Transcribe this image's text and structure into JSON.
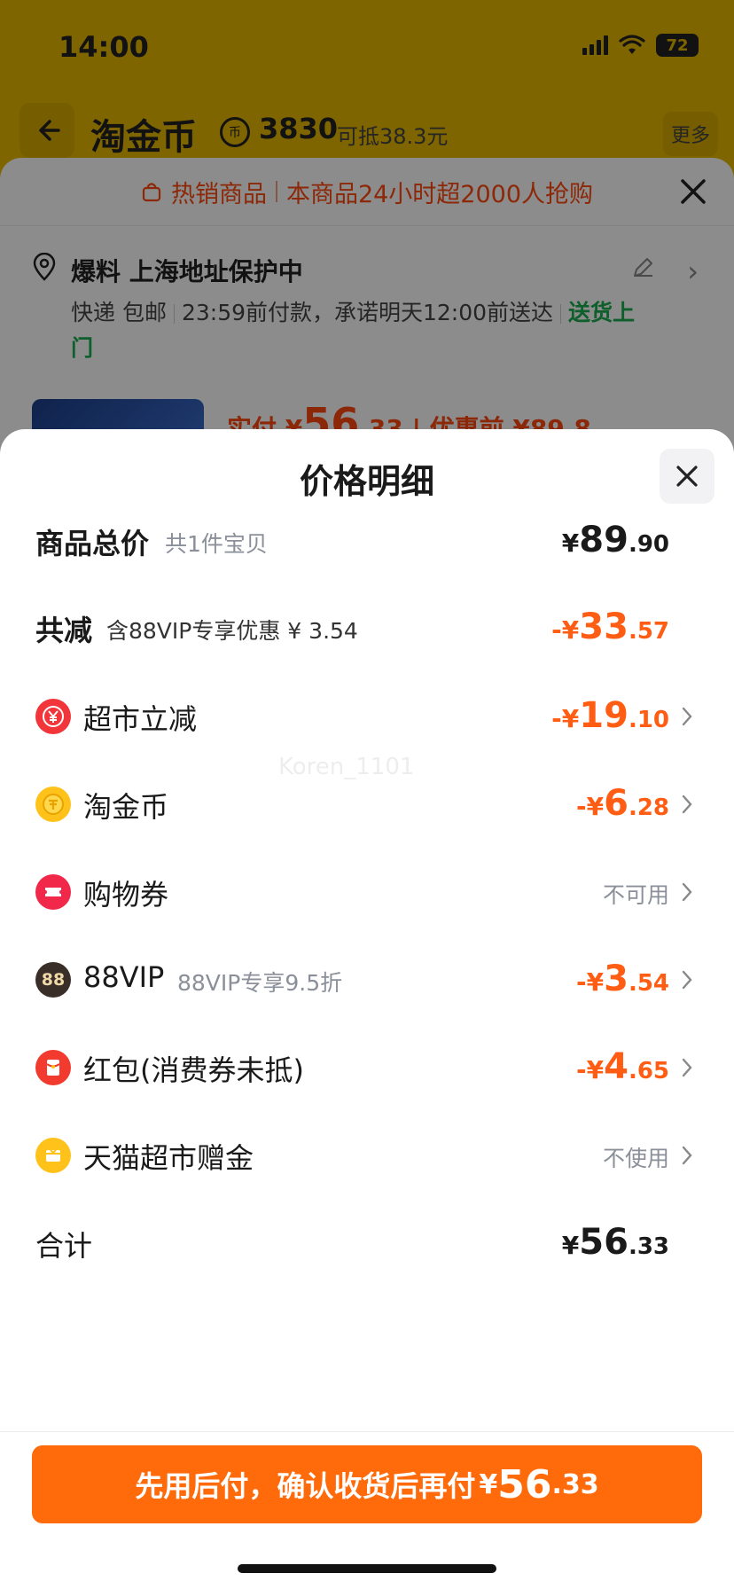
{
  "status_bar": {
    "time": "14:00",
    "battery": "72"
  },
  "nav": {
    "title": "淘金币",
    "coin_icon": "coin-icon",
    "coins": "3830",
    "deduct_text": "可抵38.3元",
    "more": "更多"
  },
  "order": {
    "banner_hot": "热销商品",
    "banner_text": "本商品24小时超2000人抢购",
    "address_title": "爆料 上海地址保护中",
    "delivery_method": "快递 包邮",
    "delivery_promise": "23:59前付款，承诺明天12:00前送达",
    "delivery_tag": "送货上门",
    "paid_prefix": "实付 ¥",
    "paid_int": "56",
    "paid_dec": ".33",
    "before_discount": "| 优惠前 ¥89.8"
  },
  "detail": {
    "title": "价格明细",
    "watermark": "Koren_1101",
    "rows": [
      {
        "label": "商品总价",
        "sub": "共1件宝贝",
        "yen": "¥",
        "int": "89",
        "dec": ".90"
      },
      {
        "label": "共减",
        "sub": "含88VIP专享优惠 ¥ 3.54",
        "yen": "-¥",
        "int": "33",
        "dec": ".57"
      },
      {
        "icon": "discount-icon",
        "label": "超市立减",
        "yen": "-¥",
        "int": "19",
        "dec": ".10"
      },
      {
        "icon": "coin-icon",
        "label": "淘金币",
        "yen": "-¥",
        "int": "6",
        "dec": ".28"
      },
      {
        "icon": "coupon-icon",
        "label": "购物券",
        "status": "不可用"
      },
      {
        "icon": "vip-icon",
        "icon_text": "88",
        "label": "88VIP",
        "sub": "88VIP专享9.5折",
        "yen": "-¥",
        "int": "3",
        "dec": ".54"
      },
      {
        "icon": "red-packet-icon",
        "label": "红包(消费券未抵)",
        "yen": "-¥",
        "int": "4",
        "dec": ".65"
      },
      {
        "icon": "gift-card-icon",
        "label": "天猫超市赠金",
        "status": "不使用"
      },
      {
        "label": "合计",
        "yen": "¥",
        "int": "56",
        "dec": ".33"
      }
    ],
    "pay_button": {
      "text": "先用后付，确认收货后再付",
      "yen": "¥",
      "int": "56",
      "dec": ".33"
    }
  },
  "colors": {
    "accent_orange": "#ff6a0a",
    "amount_orange": "#ff5d14",
    "green": "#1aad50"
  }
}
